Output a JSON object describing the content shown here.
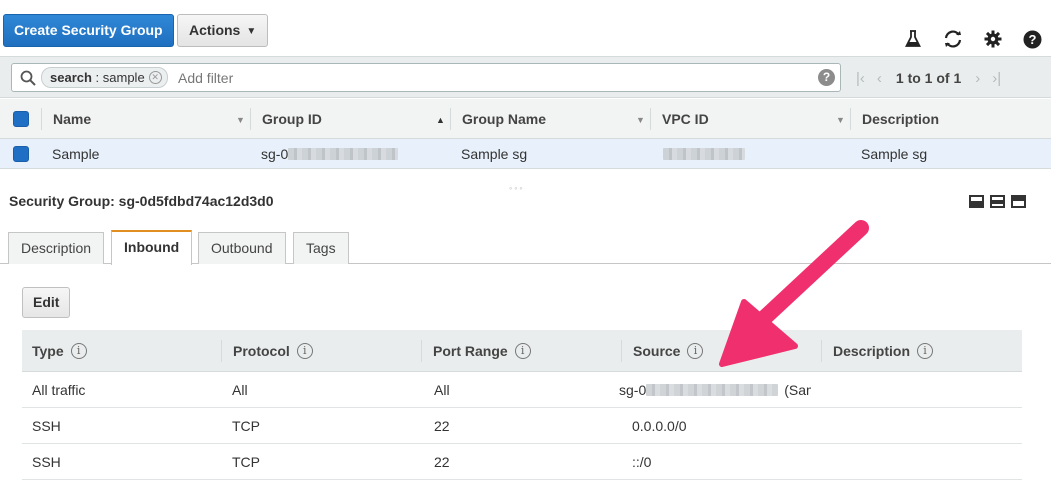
{
  "toolbar": {
    "create_label": "Create Security Group",
    "actions_label": "Actions"
  },
  "filter": {
    "token_key": "search",
    "token_value": "sample",
    "placeholder": "Add filter",
    "pagination": "1 to 1 of 1"
  },
  "grid": {
    "columns": [
      "Name",
      "Group ID",
      "Group Name",
      "VPC ID",
      "Description"
    ],
    "rows": [
      {
        "name": "Sample",
        "group_id_prefix": "sg-0",
        "group_name": "Sample sg",
        "description": "Sample sg"
      }
    ]
  },
  "details": {
    "title": "Security Group: sg-0d5fdbd74ac12d3d0",
    "tabs": [
      "Description",
      "Inbound",
      "Outbound",
      "Tags"
    ],
    "active_tab": "Inbound",
    "edit_label": "Edit",
    "rule_columns": [
      "Type",
      "Protocol",
      "Port Range",
      "Source",
      "Description"
    ],
    "rules": [
      {
        "type": "All traffic",
        "protocol": "All",
        "port": "All",
        "source_prefix": "sg-0",
        "source_suffix": "(Samp",
        "description": ""
      },
      {
        "type": "SSH",
        "protocol": "TCP",
        "port": "22",
        "source": "0.0.0.0/0",
        "description": ""
      },
      {
        "type": "SSH",
        "protocol": "TCP",
        "port": "22",
        "source": "::/0",
        "description": ""
      }
    ]
  },
  "icons": [
    "flask-icon",
    "refresh-icon",
    "gear-icon",
    "help-icon",
    "search-icon",
    "clear-token-icon",
    "info-icon"
  ],
  "colors": {
    "primary": "#1f6fbf",
    "selected_row": "#e8f1fb",
    "active_tab_accent": "#e28f22",
    "annotation_arrow": "#f0306e"
  }
}
